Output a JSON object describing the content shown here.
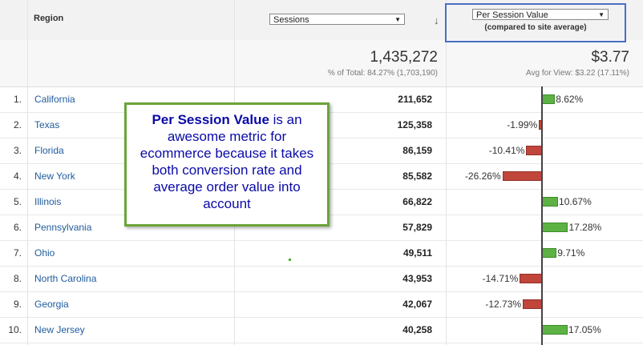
{
  "header": {
    "region_label": "Region",
    "sessions_select": "Sessions",
    "sort_arrow": "↓",
    "psv_select": "Per Session Value",
    "compare_note": "(compared to site average)"
  },
  "totals": {
    "sessions": "1,435,272",
    "sessions_note": "% of Total: 84.27% (1,703,190)",
    "psv": "$3.77",
    "psv_note": "Avg for View: $3.22 (17.11%)"
  },
  "rows": [
    {
      "num": "1.",
      "region": "California",
      "sessions": "211,652",
      "pct": "8.62%",
      "value": 8.62
    },
    {
      "num": "2.",
      "region": "Texas",
      "sessions": "125,358",
      "pct": "-1.99%",
      "value": -1.99
    },
    {
      "num": "3.",
      "region": "Florida",
      "sessions": "86,159",
      "pct": "-10.41%",
      "value": -10.41
    },
    {
      "num": "4.",
      "region": "New York",
      "sessions": "85,582",
      "pct": "-26.26%",
      "value": -26.26
    },
    {
      "num": "5.",
      "region": "Illinois",
      "sessions": "66,822",
      "pct": "10.67%",
      "value": 10.67
    },
    {
      "num": "6.",
      "region": "Pennsylvania",
      "sessions": "57,829",
      "pct": "17.28%",
      "value": 17.28
    },
    {
      "num": "7.",
      "region": "Ohio",
      "sessions": "49,511",
      "pct": "9.71%",
      "value": 9.71
    },
    {
      "num": "8.",
      "region": "North Carolina",
      "sessions": "43,953",
      "pct": "-14.71%",
      "value": -14.71
    },
    {
      "num": "9.",
      "region": "Georgia",
      "sessions": "42,067",
      "pct": "-12.73%",
      "value": -12.73
    },
    {
      "num": "10.",
      "region": "New Jersey",
      "sessions": "40,258",
      "pct": "17.05%",
      "value": 17.05
    }
  ],
  "callout": {
    "bold": "Per Session Value",
    "rest": " is an awesome metric for ecommerce because it takes both conversion rate and average order value into account"
  },
  "colors": {
    "positive": "#5cb243",
    "negative": "#c0463c",
    "link": "#1f5b9c",
    "highlight": "#4a6fc2",
    "callout_border": "#6ba43a"
  }
}
